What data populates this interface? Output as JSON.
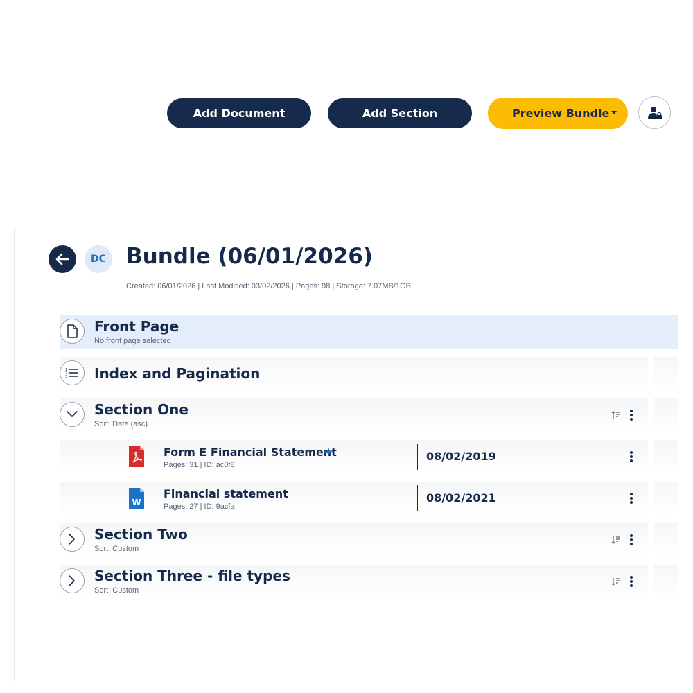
{
  "toolbar": {
    "add_document": "Add Document",
    "add_section": "Add Section",
    "preview_bundle": "Preview Bundle"
  },
  "bundle": {
    "avatar_initials": "DC",
    "title": "Bundle (06/01/2026)",
    "meta": "Created: 06/01/2026 | Last Modified: 03/02/2026 | Pages: 98 | Storage: 7.07MB/1GB"
  },
  "rows": {
    "front_page": {
      "title": "Front Page",
      "subtitle": "No front page selected"
    },
    "index": {
      "title": "Index and Pagination"
    },
    "section_one": {
      "title": "Section One",
      "sort": "Sort: Date (asc)"
    },
    "section_two": {
      "title": "Section Two",
      "sort": "Sort: Custom"
    },
    "section_three": {
      "title": "Section Three - file types",
      "sort": "Sort: Custom"
    }
  },
  "documents": [
    {
      "title": "Form E Financial Statement",
      "meta": "Pages: 31 | ID: ac0f8",
      "date": "08/02/2019",
      "type": "pdf-icon"
    },
    {
      "title": "Financial statement",
      "meta": "Pages: 27 | ID: 9acfa",
      "date": "08/02/2021",
      "type": "word-icon"
    }
  ],
  "colors": {
    "navy": "#162a4b",
    "accent_yellow": "#fcbc03",
    "front_page_highlight": "#e4eefb",
    "pdf_red": "#d92b2b",
    "word_blue": "#1a73c8"
  }
}
